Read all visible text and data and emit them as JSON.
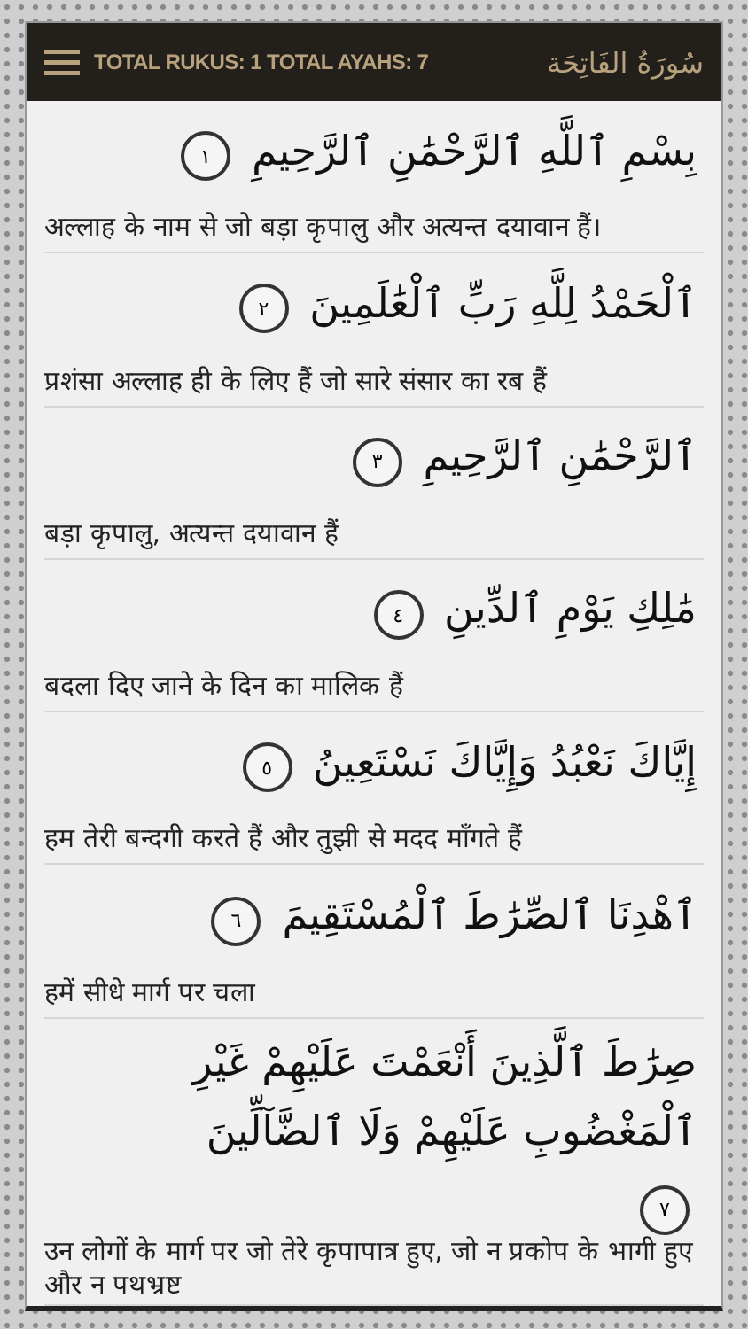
{
  "header": {
    "stats": "TOTAL RUKUS: 1 TOTAL AYAHS: 7",
    "surah_title": "سُورَةُ الفَاتِحَة"
  },
  "verses": [
    {
      "arabic": "بِسْمِ ٱللَّهِ ٱلرَّحْمَٰنِ ٱلرَّحِيمِ",
      "number": "١",
      "translation": "अल्लाह के नाम से जो बड़ा कृपालु और अत्यन्त दयावान हैं।"
    },
    {
      "arabic": "ٱلْحَمْدُ لِلَّهِ رَبِّ ٱلْعَٰلَمِينَ",
      "number": "٢",
      "translation": "प्रशंसा अल्लाह ही के लिए हैं जो सारे संसार का रब हैं"
    },
    {
      "arabic": "ٱلرَّحْمَٰنِ ٱلرَّحِيمِ",
      "number": "٣",
      "translation": "बड़ा कृपालु, अत्यन्त दयावान हैं"
    },
    {
      "arabic": "مَٰلِكِ يَوْمِ ٱلدِّينِ",
      "number": "٤",
      "translation": "बदला दिए जाने के दिन का मालिक हैं"
    },
    {
      "arabic": "إِيَّاكَ نَعْبُدُ وَإِيَّاكَ نَسْتَعِينُ",
      "number": "٥",
      "translation": "हम तेरी बन्दगी करते हैं और तुझी से मदद माँगते हैं"
    },
    {
      "arabic": "ٱهْدِنَا ٱلصِّرَٰطَ ٱلْمُسْتَقِيمَ",
      "number": "٦",
      "translation": "हमें सीधे मार्ग पर चला"
    },
    {
      "arabic": "صِرَٰطَ ٱلَّذِينَ أَنْعَمْتَ عَلَيْهِمْ غَيْرِ ٱلْمَغْضُوبِ عَلَيْهِمْ وَلَا ٱلضَّآلِّينَ",
      "number": "٧",
      "translation": "उन लोगों के मार्ग पर जो तेरे कृपापात्र हुए, जो न प्रकोप के भागी हुए और न पथभ्रष्ट"
    }
  ]
}
